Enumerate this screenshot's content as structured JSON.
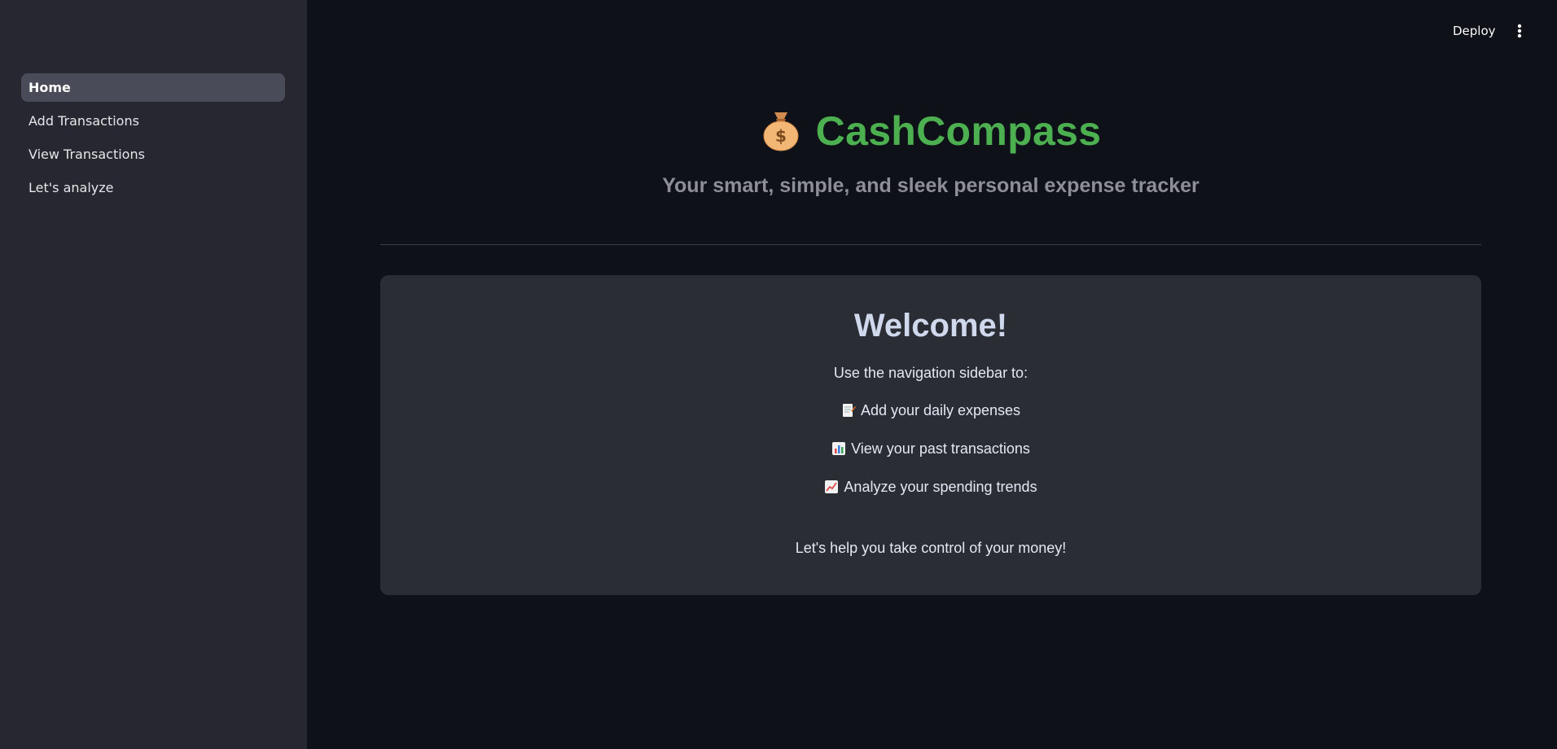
{
  "sidebar": {
    "items": [
      {
        "label": "Home",
        "active": true
      },
      {
        "label": "Add Transactions",
        "active": false
      },
      {
        "label": "View Transactions",
        "active": false
      },
      {
        "label": "Let's analyze",
        "active": false
      }
    ]
  },
  "header": {
    "deploy_label": "Deploy",
    "menu_icon": "more-vert-icon"
  },
  "main": {
    "title": "CashCompass",
    "title_icon": "money-bag-icon",
    "subtitle": "Your smart, simple, and sleek personal expense tracker",
    "welcome": {
      "title": "Welcome!",
      "intro": "Use the navigation sidebar to:",
      "bullets": [
        {
          "icon": "memo-icon",
          "text": "Add your daily expenses"
        },
        {
          "icon": "bar-chart-icon",
          "text": "View your past transactions"
        },
        {
          "icon": "chart-increasing-icon",
          "text": "Analyze your spending trends"
        }
      ],
      "closing": "Let's help you take control of your money!"
    }
  },
  "colors": {
    "background": "#0e1117",
    "sidebar": "#262730",
    "accent_green": "#4caf50",
    "card": "#2a2d34",
    "active_nav": "#4a4b58"
  }
}
